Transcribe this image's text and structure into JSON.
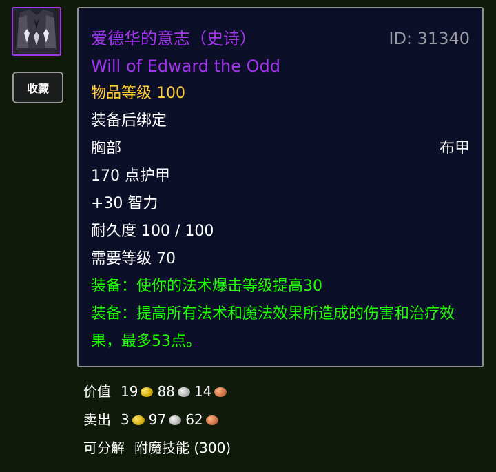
{
  "item": {
    "name_cn": "爱德华的意志（史诗）",
    "id_label": "ID: 31340",
    "name_en": "Will of Edward the Odd",
    "item_level": "物品等级 100",
    "bind": "装备后绑定",
    "slot": "胸部",
    "armor_type": "布甲",
    "armor": "170 点护甲",
    "stat": "+30 智力",
    "durability": "耐久度 100 / 100",
    "required_level": "需要等级 70",
    "equip1": "装备：使你的法术爆击等级提高30",
    "equip2": "装备：提高所有法术和魔法效果所造成的伤害和治疗效果，最多53点。"
  },
  "favorite_button": "收藏",
  "value": {
    "label": "价值",
    "gold": "19",
    "silver": "88",
    "copper": "14"
  },
  "sell": {
    "label": "卖出",
    "gold": "3",
    "silver": "97",
    "copper": "62"
  },
  "disenchant": {
    "label": "可分解",
    "value": "附魔技能 (300)"
  },
  "colors": {
    "epic": "#a335ee",
    "item_level": "#ffcc33",
    "equip_effect": "#1eff00",
    "tooltip_bg": "#0c0f28",
    "page_bg": "#0f1a0b"
  },
  "icons": {
    "item": "robe-chest-icon",
    "gold": "gold-coin-icon",
    "silver": "silver-coin-icon",
    "copper": "copper-coin-icon"
  }
}
